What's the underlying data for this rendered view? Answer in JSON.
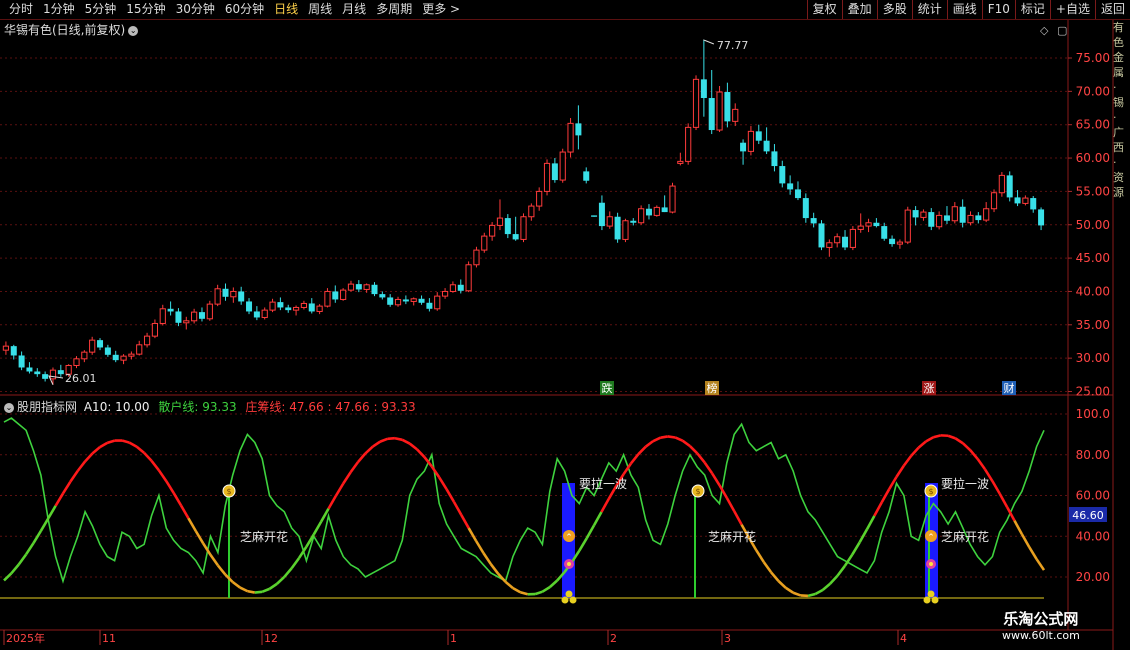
{
  "toolbar": {
    "periods": [
      "分时",
      "1分钟",
      "5分钟",
      "15分钟",
      "30分钟",
      "60分钟",
      "日线",
      "周线",
      "月线",
      "多周期",
      "更多 >"
    ],
    "active_period": "日线",
    "right_buttons": [
      "复权",
      "叠加",
      "多股",
      "统计",
      "画线",
      "F10",
      "标记",
      "+自选",
      "返回"
    ]
  },
  "stock": {
    "title": "华锡有色(日线,前复权)",
    "high_label": "77.77",
    "low_label": "26.01"
  },
  "price_axis": [
    "75.00",
    "70.00",
    "65.00",
    "60.00",
    "55.00",
    "50.00",
    "45.00",
    "40.00",
    "35.00",
    "30.00",
    "25.00"
  ],
  "indicator": {
    "name": "股朋指标网",
    "a10": "A10: 10.00",
    "sanhu": "散户线: 93.33",
    "zhuang": "庄筹线: 47.66 : 47.66 : 93.33",
    "axis": [
      "100.0",
      "80.00",
      "60.00",
      "40.00",
      "20.00"
    ],
    "current": "46.60",
    "annotations": {
      "lalapo": "要拉一波",
      "zhima": "芝麻开花"
    }
  },
  "event_tags": [
    "跌",
    "榜",
    "涨",
    "财"
  ],
  "time_axis": [
    "2025年",
    "11",
    "12",
    "1",
    "2",
    "3",
    "4"
  ],
  "side_text": "有色金属 · 锡 · 广西 · 资源",
  "watermark": {
    "line1": "乐淘公式网",
    "line2": "www.60lt.com"
  },
  "colors": {
    "up": "#ff3b3b",
    "down": "#39e0e8",
    "sanhu": "#3ed23e",
    "zhuang": "#ff1a1a",
    "grid": "#5a1010"
  },
  "chart_data": {
    "type": "candlestick",
    "candles": [
      [
        31.2,
        32.5,
        30.5,
        31.8
      ],
      [
        31.8,
        32.0,
        29.8,
        30.4
      ],
      [
        30.4,
        31.0,
        28.2,
        28.6
      ],
      [
        28.6,
        29.4,
        27.7,
        28.0
      ],
      [
        28.0,
        28.5,
        27.2,
        27.6
      ],
      [
        27.6,
        28.0,
        26.5,
        26.9
      ],
      [
        26.9,
        28.6,
        26.01,
        28.2
      ],
      [
        28.2,
        29.0,
        27.2,
        27.6
      ],
      [
        27.6,
        29.1,
        27.2,
        28.9
      ],
      [
        28.9,
        30.3,
        28.5,
        29.9
      ],
      [
        29.9,
        31.2,
        29.4,
        30.9
      ],
      [
        30.9,
        33.2,
        30.5,
        32.7
      ],
      [
        32.7,
        33.0,
        31.2,
        31.6
      ],
      [
        31.6,
        32.0,
        30.2,
        30.5
      ],
      [
        30.5,
        31.1,
        29.4,
        29.7
      ],
      [
        29.7,
        30.6,
        29.1,
        30.3
      ],
      [
        30.3,
        31.0,
        29.8,
        30.6
      ],
      [
        30.6,
        32.6,
        30.4,
        32.0
      ],
      [
        32.0,
        33.8,
        31.6,
        33.3
      ],
      [
        33.3,
        35.8,
        33.0,
        35.2
      ],
      [
        35.2,
        38.0,
        34.9,
        37.4
      ],
      [
        37.4,
        38.5,
        36.4,
        37.0
      ],
      [
        37.0,
        37.5,
        34.8,
        35.3
      ],
      [
        35.3,
        36.2,
        34.3,
        35.6
      ],
      [
        35.6,
        37.4,
        35.2,
        36.9
      ],
      [
        36.9,
        37.6,
        35.5,
        35.9
      ],
      [
        35.9,
        38.6,
        35.6,
        38.1
      ],
      [
        38.1,
        41.0,
        37.8,
        40.4
      ],
      [
        40.4,
        41.2,
        38.6,
        39.2
      ],
      [
        39.2,
        40.6,
        38.3,
        40.0
      ],
      [
        40.0,
        40.7,
        38.0,
        38.5
      ],
      [
        38.5,
        39.0,
        36.6,
        37.0
      ],
      [
        37.0,
        37.8,
        35.7,
        36.1
      ],
      [
        36.1,
        37.6,
        35.8,
        37.2
      ],
      [
        37.2,
        38.9,
        36.9,
        38.4
      ],
      [
        38.4,
        39.1,
        37.2,
        37.6
      ],
      [
        37.6,
        38.0,
        36.8,
        37.2
      ],
      [
        37.2,
        37.9,
        36.4,
        37.6
      ],
      [
        37.6,
        38.6,
        37.3,
        38.2
      ],
      [
        38.2,
        39.0,
        36.7,
        37.0
      ],
      [
        37.0,
        38.1,
        36.6,
        37.8
      ],
      [
        37.8,
        40.5,
        37.6,
        40.0
      ],
      [
        40.0,
        40.9,
        38.3,
        38.8
      ],
      [
        38.8,
        40.5,
        38.6,
        40.2
      ],
      [
        40.2,
        41.6,
        40.0,
        41.1
      ],
      [
        41.1,
        41.7,
        39.9,
        40.3
      ],
      [
        40.3,
        41.2,
        39.8,
        41.0
      ],
      [
        41.0,
        41.4,
        39.3,
        39.6
      ],
      [
        39.6,
        40.0,
        38.8,
        39.1
      ],
      [
        39.1,
        39.6,
        37.7,
        38.0
      ],
      [
        38.0,
        39.2,
        37.7,
        38.8
      ],
      [
        38.8,
        39.4,
        38.1,
        38.5
      ],
      [
        38.5,
        39.1,
        37.9,
        38.9
      ],
      [
        38.9,
        39.4,
        38.0,
        38.3
      ],
      [
        38.3,
        39.0,
        37.0,
        37.4
      ],
      [
        37.4,
        39.9,
        37.1,
        39.3
      ],
      [
        39.3,
        40.5,
        38.9,
        40.0
      ],
      [
        40.0,
        41.5,
        39.8,
        41.0
      ],
      [
        41.0,
        41.8,
        39.7,
        40.1
      ],
      [
        40.1,
        44.5,
        39.9,
        44.0
      ],
      [
        44.0,
        46.7,
        43.6,
        46.2
      ],
      [
        46.2,
        48.8,
        45.8,
        48.3
      ],
      [
        48.3,
        50.4,
        47.6,
        49.9
      ],
      [
        49.9,
        53.8,
        49.2,
        51.0
      ],
      [
        51.0,
        51.6,
        48.0,
        48.6
      ],
      [
        48.6,
        51.2,
        47.6,
        47.8
      ],
      [
        47.8,
        51.7,
        47.4,
        51.2
      ],
      [
        51.2,
        53.2,
        50.6,
        52.8
      ],
      [
        52.8,
        55.6,
        52.1,
        55.0
      ],
      [
        55.0,
        59.8,
        54.4,
        59.2
      ],
      [
        59.2,
        60.0,
        56.3,
        56.7
      ],
      [
        56.7,
        61.4,
        56.3,
        60.9
      ],
      [
        60.9,
        66.0,
        60.1,
        65.2
      ],
      [
        65.2,
        67.9,
        61.3,
        63.4
      ],
      [
        58.0,
        58.6,
        56.2,
        56.6
      ],
      [
        51.4,
        51.4,
        51.2,
        51.2
      ],
      [
        53.3,
        54.4,
        49.2,
        49.8
      ],
      [
        49.8,
        52.0,
        49.4,
        51.2
      ],
      [
        51.2,
        51.8,
        47.3,
        47.8
      ],
      [
        47.8,
        50.9,
        47.4,
        50.6
      ],
      [
        50.6,
        51.0,
        49.9,
        50.3
      ],
      [
        50.3,
        52.9,
        50.0,
        52.4
      ],
      [
        52.4,
        53.1,
        50.8,
        51.4
      ],
      [
        51.4,
        52.9,
        51.2,
        52.6
      ],
      [
        52.6,
        54.4,
        51.9,
        51.9
      ],
      [
        51.9,
        56.3,
        51.7,
        55.8
      ],
      [
        59.2,
        60.8,
        58.9,
        59.5
      ],
      [
        59.5,
        65.2,
        59.0,
        64.6
      ],
      [
        64.6,
        72.4,
        64.2,
        71.8
      ],
      [
        71.8,
        77.77,
        66.2,
        69.0
      ],
      [
        69.0,
        73.2,
        63.6,
        64.2
      ],
      [
        64.2,
        70.8,
        63.9,
        69.9
      ],
      [
        69.9,
        71.3,
        64.6,
        65.5
      ],
      [
        65.5,
        68.2,
        64.8,
        67.3
      ],
      [
        62.3,
        62.8,
        59.0,
        61.0
      ],
      [
        61.0,
        64.8,
        60.4,
        64.0
      ],
      [
        64.0,
        65.0,
        62.1,
        62.6
      ],
      [
        62.6,
        64.6,
        60.6,
        61.0
      ],
      [
        61.0,
        62.1,
        58.0,
        58.8
      ],
      [
        58.8,
        59.6,
        55.6,
        56.2
      ],
      [
        56.2,
        57.4,
        54.5,
        55.3
      ],
      [
        55.3,
        56.5,
        53.7,
        54.0
      ],
      [
        54.0,
        54.7,
        50.3,
        51.0
      ],
      [
        51.0,
        51.8,
        49.6,
        50.2
      ],
      [
        50.2,
        50.7,
        46.2,
        46.6
      ],
      [
        46.6,
        47.8,
        45.2,
        47.3
      ],
      [
        47.3,
        48.7,
        46.6,
        48.2
      ],
      [
        48.2,
        49.2,
        46.2,
        46.6
      ],
      [
        46.6,
        49.8,
        46.2,
        49.3
      ],
      [
        49.3,
        51.7,
        48.8,
        49.8
      ],
      [
        49.8,
        50.9,
        48.9,
        50.3
      ],
      [
        50.3,
        51.0,
        49.6,
        49.8
      ],
      [
        49.8,
        50.3,
        47.6,
        47.9
      ],
      [
        47.9,
        48.4,
        46.7,
        47.1
      ],
      [
        47.1,
        47.8,
        46.4,
        47.4
      ],
      [
        47.4,
        52.7,
        47.1,
        52.2
      ],
      [
        52.2,
        52.8,
        49.9,
        51.1
      ],
      [
        51.1,
        52.3,
        50.6,
        51.9
      ],
      [
        51.9,
        52.5,
        49.2,
        49.7
      ],
      [
        49.7,
        52.0,
        49.3,
        51.4
      ],
      [
        51.4,
        52.8,
        50.1,
        50.6
      ],
      [
        50.6,
        53.4,
        50.2,
        52.7
      ],
      [
        52.7,
        53.8,
        49.6,
        50.3
      ],
      [
        50.3,
        52.0,
        49.9,
        51.4
      ],
      [
        51.4,
        51.9,
        50.2,
        50.7
      ],
      [
        50.7,
        53.4,
        50.4,
        52.4
      ],
      [
        52.4,
        55.3,
        51.9,
        54.8
      ],
      [
        54.8,
        57.9,
        54.2,
        57.4
      ],
      [
        57.4,
        58.0,
        53.5,
        54.1
      ],
      [
        54.1,
        55.2,
        52.8,
        53.2
      ],
      [
        53.2,
        54.4,
        52.9,
        54.0
      ],
      [
        54.0,
        54.3,
        51.8,
        52.3
      ],
      [
        52.3,
        52.6,
        49.2,
        49.9
      ]
    ],
    "sanhu_line": [
      96,
      98,
      95,
      92,
      82,
      70,
      48,
      30,
      18,
      30,
      40,
      52,
      45,
      36,
      30,
      28,
      42,
      40,
      34,
      36,
      50,
      60,
      44,
      38,
      34,
      32,
      28,
      22,
      40,
      32,
      55,
      70,
      82,
      90,
      86,
      78,
      60,
      55,
      52,
      44,
      40,
      28,
      40,
      34,
      50,
      38,
      30,
      26,
      24,
      20,
      22,
      24,
      26,
      28,
      38,
      60,
      68,
      72,
      80,
      56,
      46,
      40,
      34,
      32,
      30,
      26,
      22,
      20,
      18,
      30,
      38,
      44,
      42,
      36,
      62,
      78,
      72,
      60,
      56,
      64,
      60,
      68,
      76,
      72,
      80,
      70,
      64,
      48,
      38,
      36,
      46,
      60,
      72,
      80,
      74,
      70,
      60,
      56,
      76,
      90,
      95,
      86,
      82,
      84,
      86,
      78,
      80,
      72,
      60,
      52,
      48,
      42,
      36,
      30,
      28,
      26,
      24,
      22,
      28,
      42,
      52,
      66,
      60,
      40,
      38,
      50,
      56,
      52,
      46,
      52,
      44,
      36,
      30,
      26,
      30,
      42,
      48,
      56,
      62,
      72,
      84,
      92
    ]
  }
}
